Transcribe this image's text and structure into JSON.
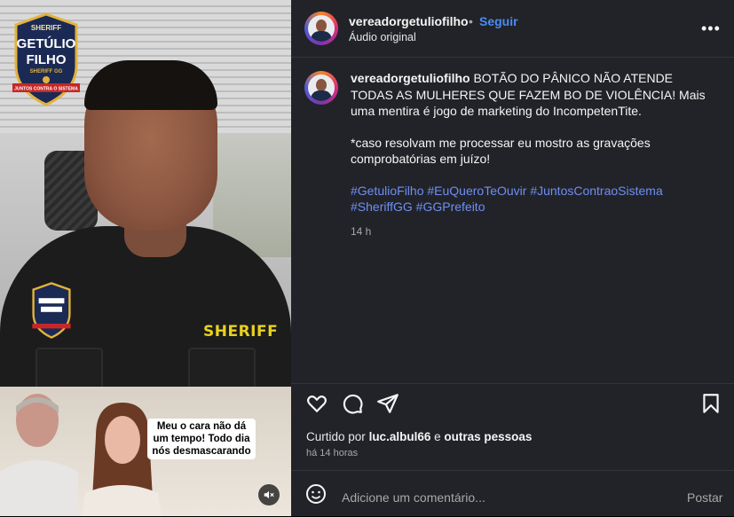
{
  "media": {
    "logo_line1": "SHERIFF",
    "logo_line2": "GETÚLIO",
    "logo_line3": "FILHO",
    "logo_line4": "SHERIFF GG",
    "logo_line5": "JUNTOS CONTRA O SISTEMA",
    "shirt_text": "SHERIFF",
    "caption": "Meu o cara não dá um tempo! Todo dia nós desmascarando"
  },
  "header": {
    "username": "vereadorgetuliofilho",
    "separator": "•",
    "follow_label": "Seguir",
    "subtitle": "Áudio original",
    "more_label": "•••"
  },
  "post": {
    "caption_user": "vereadorgetuliofilho",
    "caption_text": "BOTÃO DO PÂNICO NÃO ATENDE TODAS AS MULHERES QUE FAZEM BO DE VIOLÊNCIA! Mais uma mentira é jogo de marketing do IncompetenTite.",
    "caption_text2": "*caso resolvam me processar eu mostro as gravações comprobatórias em juízo!",
    "hashtags": "#GetulioFilho #EuQueroTeOuvir #JuntosContraoSistema #SheriffGG #GGPrefeito",
    "time_ago": "14 h"
  },
  "engagement": {
    "liked_prefix": "Curtido por",
    "liked_user": "luc.albul66",
    "liked_and": "e",
    "liked_others": "outras pessoas",
    "time_ago": "há 14 horas"
  },
  "comment": {
    "placeholder": "Adicione um comentário...",
    "post_label": "Postar"
  },
  "icons": [
    "heart-icon",
    "comment-icon",
    "share-icon",
    "bookmark-icon",
    "emoji-icon",
    "mute-icon",
    "more-icon"
  ],
  "colors": {
    "follow": "#4a8cf5",
    "hashtag": "#6e8ff5",
    "panel_bg": "#212328"
  }
}
